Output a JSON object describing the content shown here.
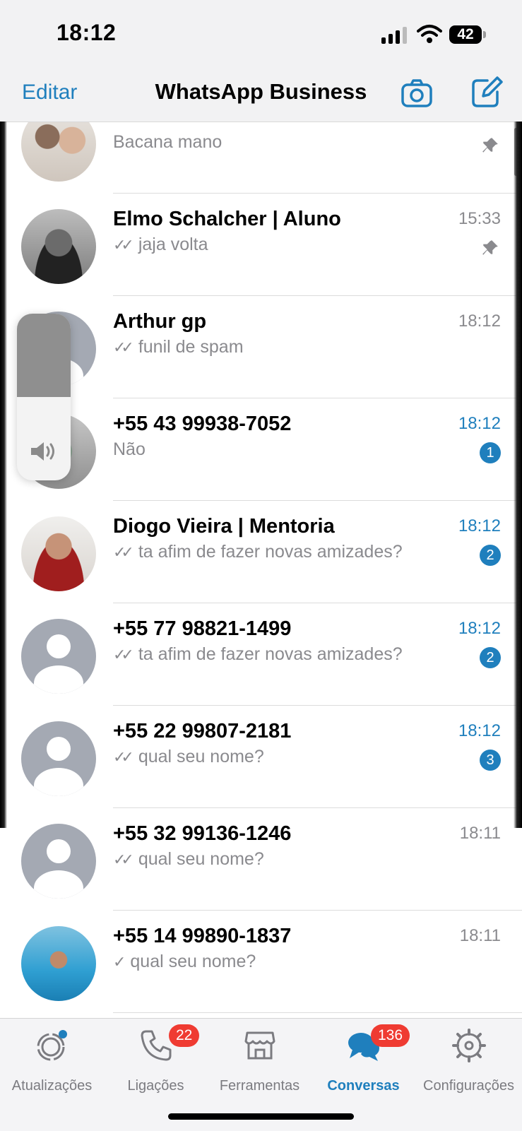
{
  "status_bar": {
    "time": "18:12",
    "battery": "42"
  },
  "nav": {
    "edit": "Editar",
    "title": "WhatsApp Business"
  },
  "chats": [
    {
      "name": "",
      "message": "Bacana mano",
      "time": "",
      "ticks": "",
      "badge": "",
      "pinned": true
    },
    {
      "name": "Elmo Schalcher | Aluno",
      "message": "jaja volta",
      "time": "15:33",
      "ticks": "✓✓",
      "badge": "",
      "pinned": true
    },
    {
      "name": "Arthur gp",
      "message": "funil de spam",
      "time": "18:12",
      "ticks": "✓✓",
      "badge": "",
      "pinned": false
    },
    {
      "name": "+55 43 99938-7052",
      "message": "Não",
      "time": "18:12",
      "ticks": "",
      "badge": "1",
      "pinned": false
    },
    {
      "name": "Diogo Vieira | Mentoria",
      "message": "ta afim de fazer novas amizades?",
      "time": "18:12",
      "ticks": "✓✓",
      "badge": "2",
      "pinned": false
    },
    {
      "name": "+55 77 98821-1499",
      "message": "ta afim de fazer novas amizades?",
      "time": "18:12",
      "ticks": "✓✓",
      "badge": "2",
      "pinned": false
    },
    {
      "name": "+55 22 99807-2181",
      "message": "qual seu nome?",
      "time": "18:12",
      "ticks": "✓✓",
      "badge": "3",
      "pinned": false
    },
    {
      "name": "+55 32 99136-1246",
      "message": "qual seu nome?",
      "time": "18:11",
      "ticks": "✓✓",
      "badge": "",
      "pinned": false
    },
    {
      "name": "+55 14 99890-1837",
      "message": "qual seu nome?",
      "time": "18:11",
      "ticks": "✓",
      "badge": "",
      "pinned": false
    }
  ],
  "volume": {
    "level": 0.5
  },
  "tabs": [
    {
      "label": "Atualizações",
      "icon": "updates-icon",
      "badge": "",
      "active": false
    },
    {
      "label": "Ligações",
      "icon": "phone-icon",
      "badge": "22",
      "active": false
    },
    {
      "label": "Ferramentas",
      "icon": "store-icon",
      "badge": "",
      "active": false
    },
    {
      "label": "Conversas",
      "icon": "chats-icon",
      "badge": "136",
      "active": true
    },
    {
      "label": "Configurações",
      "icon": "gear-icon",
      "badge": "",
      "active": false
    }
  ],
  "colors": {
    "accent": "#1f7fbd",
    "badge_red": "#ef3b32",
    "avatar_gray": "#a4a9b3"
  }
}
